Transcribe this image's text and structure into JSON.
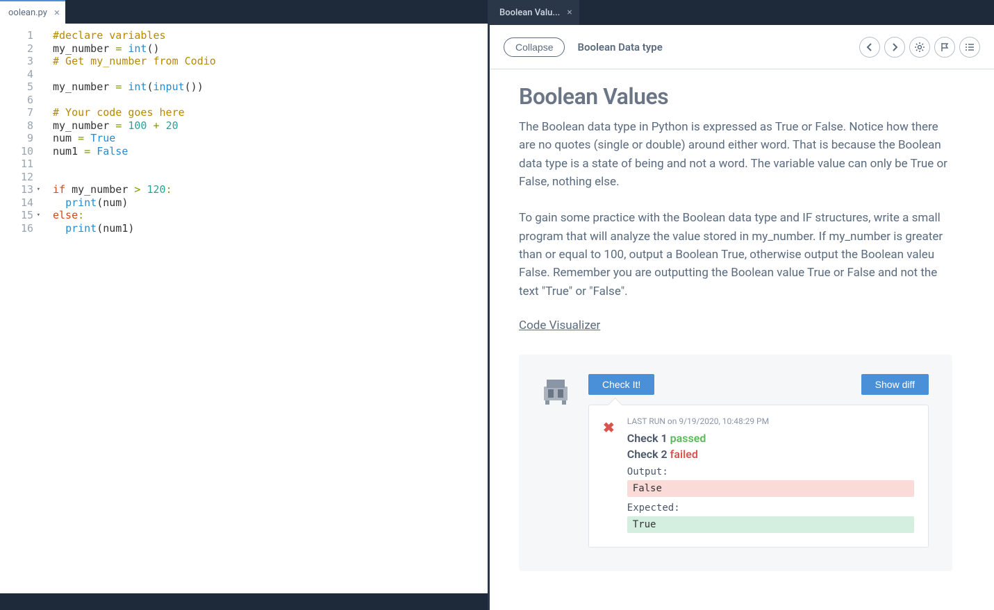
{
  "editor": {
    "tab_label": "oolean.py",
    "lines": [
      {
        "n": 1,
        "tokens": [
          {
            "t": "#declare variables",
            "c": "tk-comment"
          }
        ]
      },
      {
        "n": 2,
        "tokens": [
          {
            "t": "my_number ",
            "c": "tk-ident"
          },
          {
            "t": "=",
            "c": "tk-op"
          },
          {
            "t": " ",
            "c": ""
          },
          {
            "t": "int",
            "c": "tk-func"
          },
          {
            "t": "()",
            "c": "tk-punc"
          }
        ]
      },
      {
        "n": 3,
        "tokens": [
          {
            "t": "# Get my_number from Codio",
            "c": "tk-comment"
          }
        ]
      },
      {
        "n": 4,
        "tokens": []
      },
      {
        "n": 5,
        "tokens": [
          {
            "t": "my_number ",
            "c": "tk-ident"
          },
          {
            "t": "=",
            "c": "tk-op"
          },
          {
            "t": " ",
            "c": ""
          },
          {
            "t": "int",
            "c": "tk-func"
          },
          {
            "t": "(",
            "c": "tk-punc"
          },
          {
            "t": "input",
            "c": "tk-func"
          },
          {
            "t": "())",
            "c": "tk-punc"
          }
        ]
      },
      {
        "n": 6,
        "tokens": []
      },
      {
        "n": 7,
        "tokens": [
          {
            "t": "# Your code goes here",
            "c": "tk-comment"
          }
        ]
      },
      {
        "n": 8,
        "tokens": [
          {
            "t": "my_number ",
            "c": "tk-ident"
          },
          {
            "t": "=",
            "c": "tk-op"
          },
          {
            "t": " ",
            "c": ""
          },
          {
            "t": "100",
            "c": "tk-number"
          },
          {
            "t": " ",
            "c": ""
          },
          {
            "t": "+",
            "c": "tk-op"
          },
          {
            "t": " ",
            "c": ""
          },
          {
            "t": "20",
            "c": "tk-number"
          }
        ]
      },
      {
        "n": 9,
        "tokens": [
          {
            "t": "num ",
            "c": "tk-ident"
          },
          {
            "t": "=",
            "c": "tk-op"
          },
          {
            "t": " ",
            "c": ""
          },
          {
            "t": "True",
            "c": "tk-func"
          }
        ]
      },
      {
        "n": 10,
        "tokens": [
          {
            "t": "num1 ",
            "c": "tk-ident"
          },
          {
            "t": "=",
            "c": "tk-op"
          },
          {
            "t": " ",
            "c": ""
          },
          {
            "t": "False",
            "c": "tk-func"
          }
        ]
      },
      {
        "n": 11,
        "tokens": []
      },
      {
        "n": 12,
        "tokens": []
      },
      {
        "n": 13,
        "fold": true,
        "tokens": [
          {
            "t": "if",
            "c": "tk-keyword"
          },
          {
            "t": " my_number ",
            "c": "tk-ident"
          },
          {
            "t": ">",
            "c": "tk-op"
          },
          {
            "t": " ",
            "c": ""
          },
          {
            "t": "120",
            "c": "tk-number"
          },
          {
            "t": ":",
            "c": "tk-op"
          }
        ]
      },
      {
        "n": 14,
        "tokens": [
          {
            "t": "  ",
            "c": ""
          },
          {
            "t": "print",
            "c": "tk-func"
          },
          {
            "t": "(num)",
            "c": "tk-punc"
          }
        ]
      },
      {
        "n": 15,
        "fold": true,
        "tokens": [
          {
            "t": "else",
            "c": "tk-keyword"
          },
          {
            "t": ":",
            "c": "tk-op"
          }
        ]
      },
      {
        "n": 16,
        "tokens": [
          {
            "t": "  ",
            "c": ""
          },
          {
            "t": "print",
            "c": "tk-func"
          },
          {
            "t": "(num1)",
            "c": "tk-punc"
          }
        ]
      }
    ]
  },
  "guide": {
    "tab_label": "Boolean Valu...",
    "collapse_label": "Collapse",
    "header_title": "Boolean Data type",
    "heading": "Boolean Values",
    "para1": "The Boolean data type in Python is expressed as True or False. Notice how there are no quotes (single or double) around either word. That is because the Boolean data type is a state of being and not a word. The variable value can only be True or False, nothing else.",
    "para2": "To gain some practice with the Boolean data type and IF structures, write a small program that will analyze the value stored in my_number. If my_number is greater than or equal to 100, output a Boolean True, otherwise output the Boolean valeu False. Remember you are outputting the Boolean value True or False and not the text \"True\" or \"False\".",
    "link_label": "Code Visualizer",
    "check_it_label": "Check It!",
    "show_diff_label": "Show diff",
    "last_run": "LAST RUN on 9/19/2020, 10:48:29 PM",
    "check1_label": "Check 1",
    "check1_status": "passed",
    "check2_label": "Check 2",
    "check2_status": "failed",
    "output_label": "Output:",
    "output_value": "False",
    "expected_label": "Expected:",
    "expected_value": "True"
  }
}
